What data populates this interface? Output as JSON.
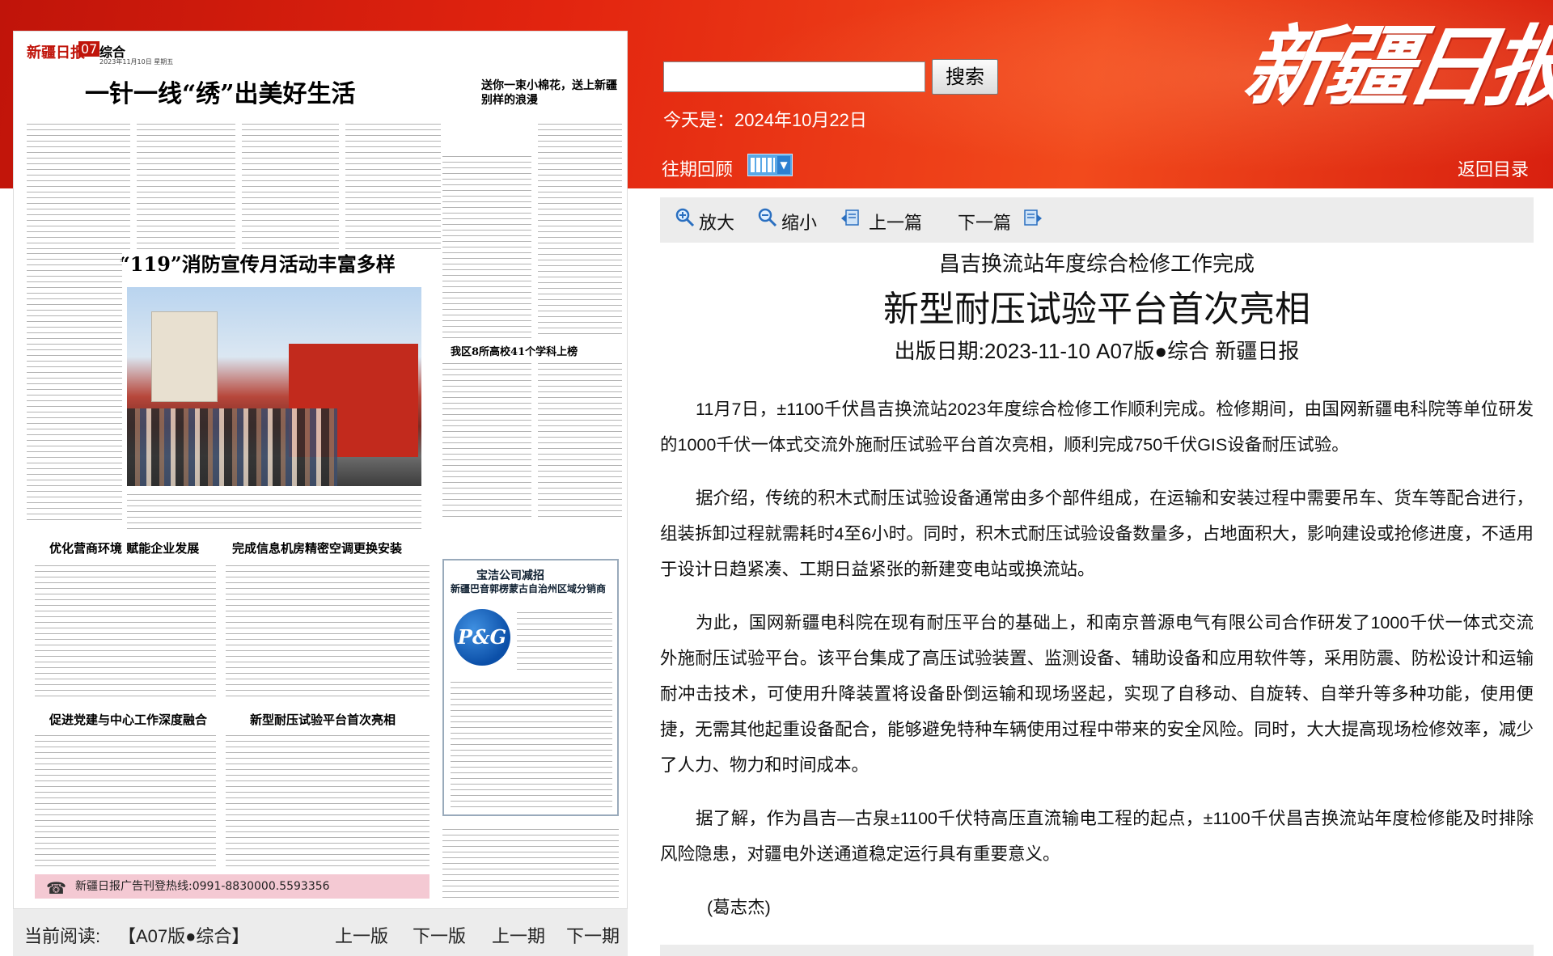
{
  "header": {
    "logo_text": "新疆日报",
    "search": {
      "value": "",
      "button_label": "搜索"
    },
    "today_text": "今天是：2024年10月22日",
    "archive_label": "往期回顾",
    "return_label": "返回目录",
    "colors": {
      "band": "#e2240f",
      "band_dark": "#c0140a"
    }
  },
  "newspaper_page": {
    "masthead": "新疆日报",
    "page_number": "07",
    "section": "综合",
    "date_line": "2023年11月10日 星期五",
    "headlines": [
      "一针一线“绣”出美好生活",
      "送你一束小棉花，送上新疆别样的浪漫",
      "“119”消防宣传月活动丰富多样",
      "我区8所高校41个学科上榜",
      "优化营商环境 赋能企业发展",
      "完成信息机房精密空调更换安装",
      "促进党建与中心工作深度融合",
      "新型耐压试验平台首次亮相"
    ],
    "ad": {
      "title": "宝洁公司减招",
      "subtitle": "新疆巴音郭楞蒙古自治州区域分销商",
      "logo_text": "P&G"
    },
    "hotline": "新疆日报广告刊登热线:0991-8830000.5593356"
  },
  "bottom_nav": {
    "current_label": "当前阅读:",
    "current_value": "【A07版●综合】",
    "links": [
      "上一版",
      "下一版",
      "上一期",
      "下一期"
    ]
  },
  "toolbar": {
    "zoom_in": "放大",
    "zoom_out": "缩小",
    "prev_article": "上一篇",
    "next_article": "下一篇"
  },
  "article": {
    "kicker": "昌吉换流站年度综合检修工作完成",
    "title": "新型耐压试验平台首次亮相",
    "meta": "出版日期:2023-11-10   A07版●综合   新疆日报",
    "paragraphs": [
      "11月7日，±1100千伏昌吉换流站2023年度综合检修工作顺利完成。检修期间，由国网新疆电科院等单位研发的1000千伏一体式交流外施耐压试验平台首次亮相，顺利完成750千伏GIS设备耐压试验。",
      "据介绍，传统的积木式耐压试验设备通常由多个部件组成，在运输和安装过程中需要吊车、货车等配合进行，组装拆卸过程就需耗时4至6小时。同时，积木式耐压试验设备数量多，占地面积大，影响建设或抢修进度，不适用于设计日趋紧凑、工期日益紧张的新建变电站或换流站。",
      "为此，国网新疆电科院在现有耐压平台的基础上，和南京普源电气有限公司合作研发了1000千伏一体式交流外施耐压试验平台。该平台集成了高压试验装置、监测设备、辅助设备和应用软件等，采用防震、防松设计和运输耐冲击技术，可使用升降装置将设备卧倒运输和现场竖起，实现了自移动、自旋转、自举升等多种功能，使用便捷，无需其他起重设备配合，能够避免特种车辆使用过程中带来的安全风险。同时，大大提高现场检修效率，减少了人力、物力和时间成本。",
      "据了解，作为昌吉—古泉±1100千伏特高压直流输电工程的起点，±1100千伏昌吉换流站年度检修能及时排除风险隐患，对疆电外送通道稳定运行具有重要意义。"
    ],
    "author": "(葛志杰)"
  }
}
